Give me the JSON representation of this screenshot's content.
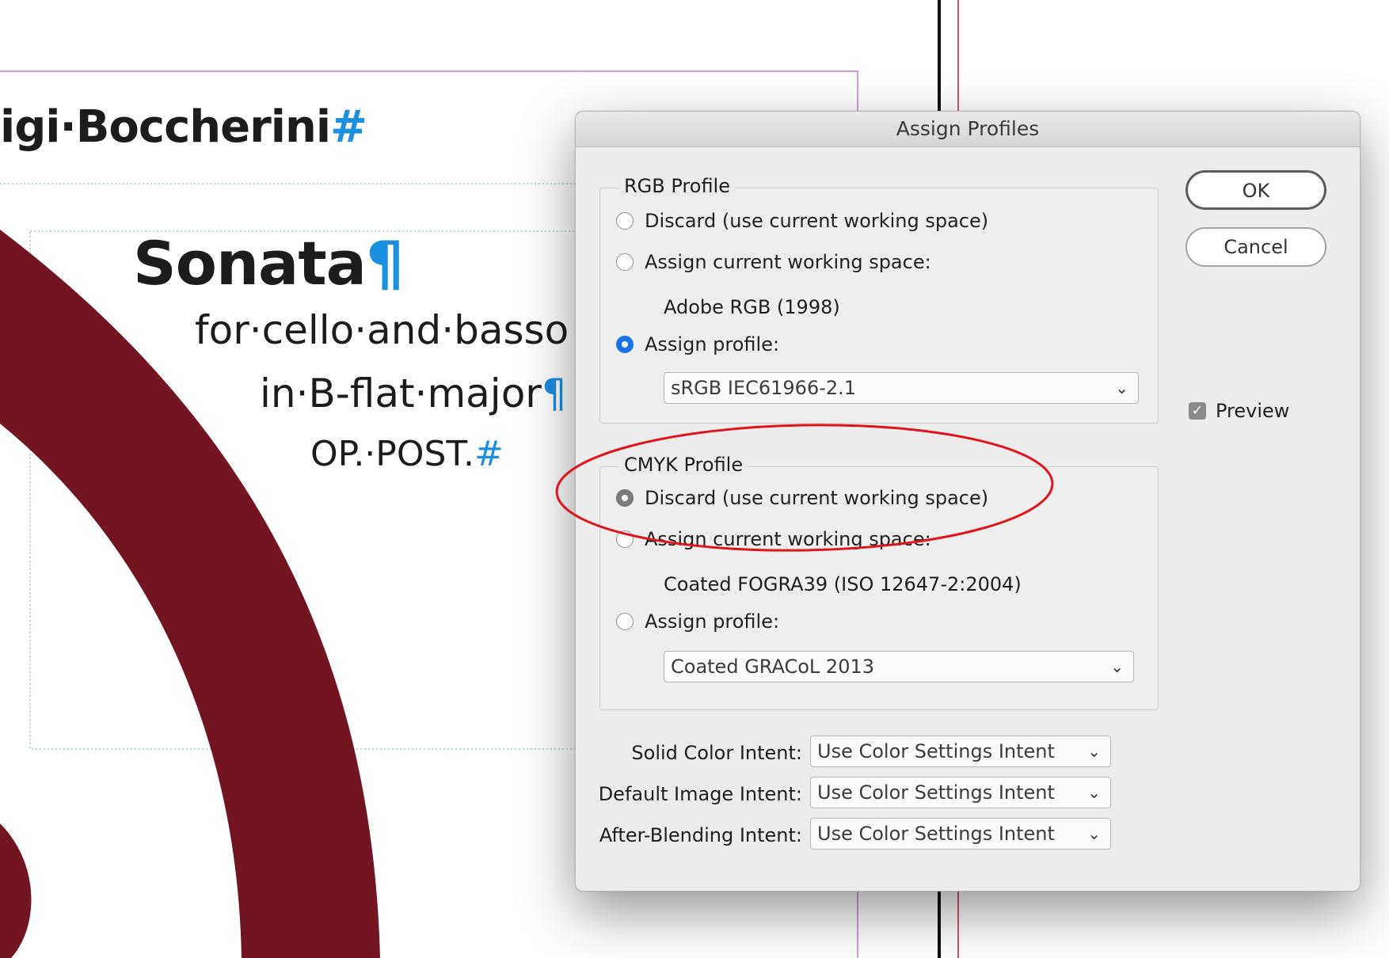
{
  "document": {
    "composer": "igi·Boccherini",
    "composer_mark": "#",
    "title": "Sonata",
    "title_mark": "¶",
    "subtitle": "for·cello·and·basso",
    "key": "in·B-flat·major",
    "key_mark": "¶",
    "opus": "OP.·POST.",
    "opus_mark": "#",
    "colors": {
      "shape": "#731422",
      "margin_guide": "#c57ad1",
      "frame_guide": "#9fcbd4",
      "hidden_chars": "#1b8fe0"
    }
  },
  "dialog": {
    "title": "Assign Profiles",
    "ok_label": "OK",
    "cancel_label": "Cancel",
    "preview_label": "Preview",
    "preview_checked": true,
    "rgb": {
      "legend": "RGB Profile",
      "option_discard": "Discard (use current working space)",
      "option_assign_current": "Assign current working space:",
      "current_space": "Adobe RGB (1998)",
      "option_assign_profile": "Assign profile:",
      "selected_option": "Assign profile:",
      "profile_value": "sRGB IEC61966-2.1"
    },
    "cmyk": {
      "legend": "CMYK Profile",
      "option_discard": "Discard (use current working space)",
      "option_assign_current": "Assign current working space:",
      "current_space": "Coated FOGRA39 (ISO 12647-2:2004)",
      "option_assign_profile": "Assign profile:",
      "selected_option": "Discard (use current working space)",
      "profile_value": "Coated GRACoL 2013"
    },
    "intents": {
      "solid_label": "Solid Color Intent:",
      "solid_value": "Use Color Settings Intent",
      "image_label": "Default Image Intent:",
      "image_value": "Use Color Settings Intent",
      "blending_label": "After-Blending Intent:",
      "blending_value": "Use Color Settings Intent"
    },
    "annotation_color": "#e0141c",
    "accent_color": "#1a74e6"
  }
}
